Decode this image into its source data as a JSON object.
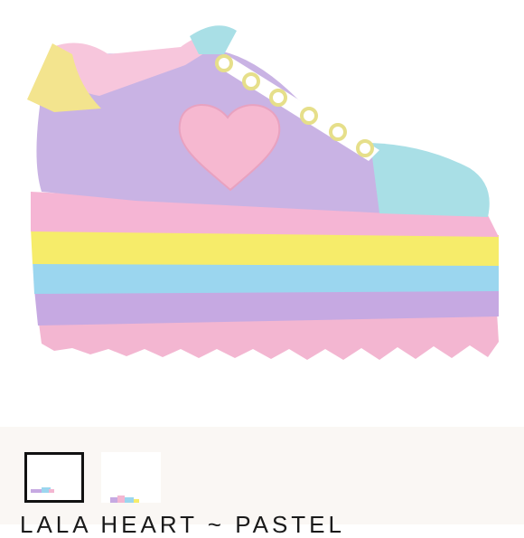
{
  "product": {
    "title": "LALA  HEART  ~  PASTEL",
    "image_icon": "pastel-platform-sneaker-image"
  },
  "gallery": {
    "thumbnails": [
      {
        "name": "thumbnail-1",
        "selected": true,
        "icon": "sneaker-side-thumbnail"
      },
      {
        "name": "thumbnail-2",
        "selected": false,
        "icon": "sneaker-angle-thumbnail"
      }
    ]
  },
  "colors": {
    "lavender": "#c9b3e4",
    "pink": "#f4b8d6",
    "yellow": "#f6ec6a",
    "blue": "#9ed8ee",
    "mint": "#a9dfe6",
    "heart": "#f6b8d0"
  }
}
